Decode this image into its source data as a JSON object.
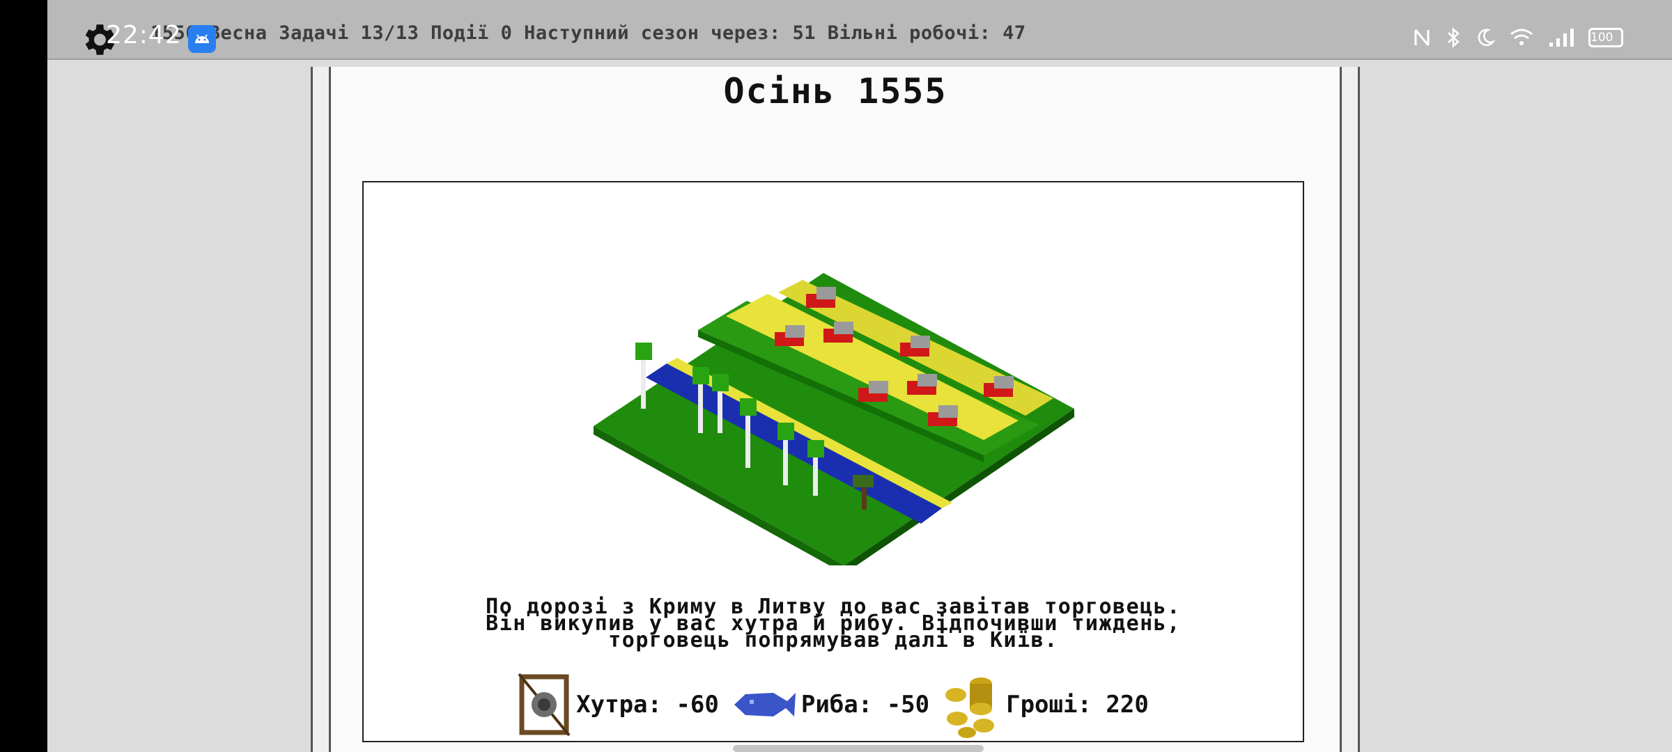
{
  "status_bar": {
    "clock": "22:42",
    "game_stats": "1556 Весна Задачі 13/13 Події 0 Наступний сезон через: 51 Вільні робочі: 47",
    "battery": "100",
    "icons": [
      "gear-icon",
      "android-notification-icon",
      "nfc-icon",
      "bluetooth-icon",
      "moon-icon",
      "wifi-icon",
      "signal-icon",
      "battery-icon"
    ]
  },
  "season_title": "Осінь 1555",
  "event": {
    "lines": [
      "По дорозі з Криму в Литву до вас завітав торговець.",
      "Він викупив у вас хутра й рибу. Відпочивши тиждень,",
      "торговець попрямував далі в Київ."
    ]
  },
  "resources": [
    {
      "icon": "fur-frame-icon",
      "label": "Хутра: -60"
    },
    {
      "icon": "fish-icon",
      "label": "Риба: -50"
    },
    {
      "icon": "coins-icon",
      "label": "Гроші: 220"
    }
  ],
  "colors": {
    "grass": "#2a9a12",
    "field": "#e8e23a",
    "river": "#1a2fb0",
    "wagon_red": "#d01818"
  }
}
